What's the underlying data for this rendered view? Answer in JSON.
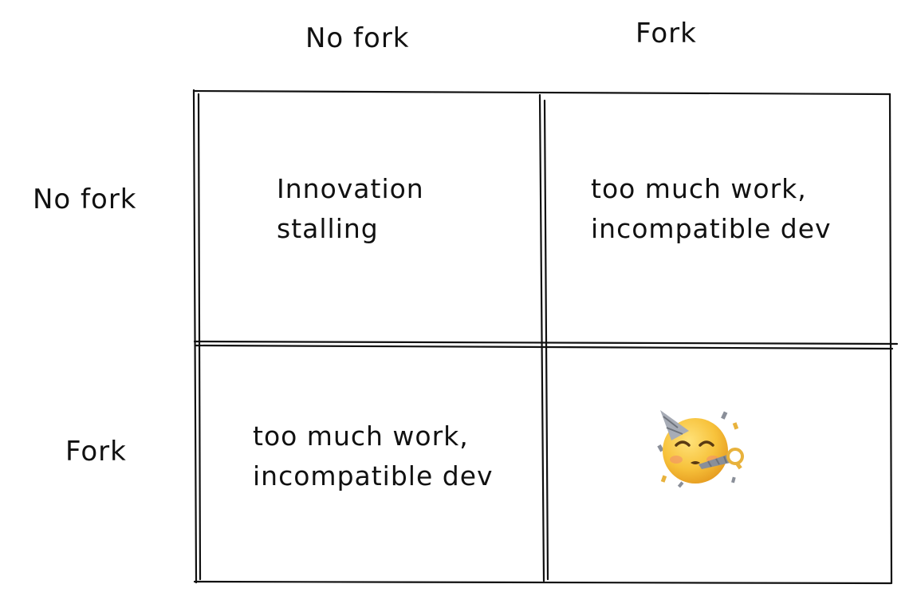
{
  "columns": {
    "no_fork": "No fork",
    "fork": "Fork"
  },
  "rows": {
    "no_fork": "No fork",
    "fork": "Fork"
  },
  "cells": {
    "no_fork_no_fork": [
      "Innovation",
      "stalling"
    ],
    "no_fork_fork": [
      "too much work,",
      "incompatible dev"
    ],
    "fork_no_fork": [
      "too much work,",
      "incompatible dev"
    ],
    "fork_fork_icon": "partying-face-emoji"
  },
  "colors": {
    "ink": "#111111",
    "emoji_face": "#F7C23B",
    "emoji_hat": "#8A8F99"
  }
}
